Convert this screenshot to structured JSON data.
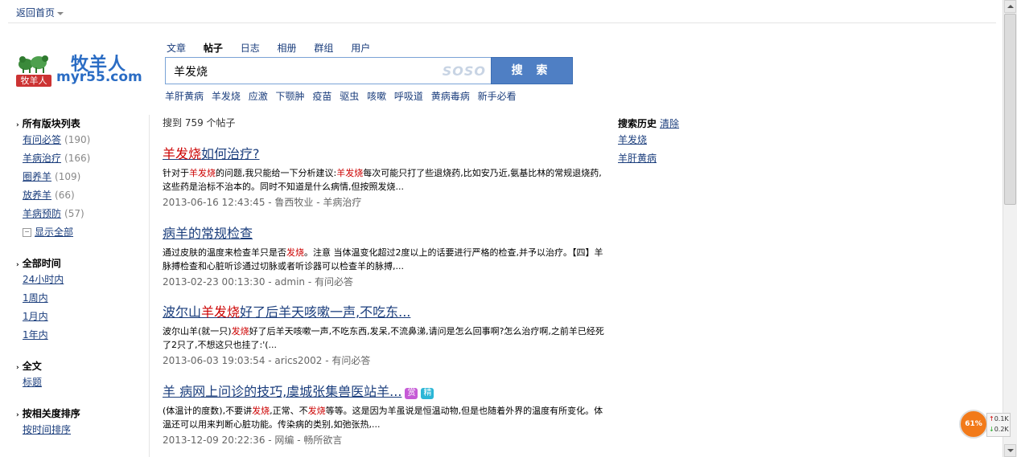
{
  "top": {
    "back_home": "返回首页"
  },
  "logo": {
    "cn": "牧羊人",
    "en": "myr55.com",
    "badge": "牧羊人"
  },
  "search": {
    "tabs": [
      "文章",
      "帖子",
      "日志",
      "相册",
      "群组",
      "用户"
    ],
    "active_tab": "帖子",
    "query": "羊发烧",
    "watermark": "SOSO",
    "button": "搜 索",
    "hot_words": [
      "羊肝黄病",
      "羊发烧",
      "应激",
      "下颚肿",
      "疫苗",
      "驱虫",
      "咳嗽",
      "呼吸道",
      "黄病毒病",
      "新手必看"
    ]
  },
  "sidebar": {
    "forums": {
      "title": "所有版块列表",
      "items": [
        {
          "label": "有问必答",
          "count": "(190)"
        },
        {
          "label": "羊病治疗",
          "count": "(166)"
        },
        {
          "label": "圈养羊",
          "count": "(109)"
        },
        {
          "label": "放养羊",
          "count": "(66)"
        },
        {
          "label": "羊病预防",
          "count": "(57)"
        }
      ],
      "show_all": "显示全部"
    },
    "time": {
      "title": "全部时间",
      "items": [
        "24小时内",
        "1周内",
        "1月内",
        "1年内"
      ]
    },
    "scope": {
      "title": "全文",
      "items": [
        "标题"
      ]
    },
    "sort": {
      "title": "按相关度排序",
      "items": [
        "按时间排序"
      ]
    }
  },
  "results": {
    "count_text": "搜到 759 个帖子",
    "items": [
      {
        "title_hl": "羊发烧",
        "title_rest": "如何治疗?",
        "title_pre": "",
        "desc_1": "针对于",
        "desc_hl1": "羊发烧",
        "desc_2": "的问题,我只能给一下分析建议:",
        "desc_hl2": "羊发烧",
        "desc_3": "每次可能只打了些退烧药,比如安乃近,氨基比林的常规退烧药,这些药是治标不治本的。同时不知道是什么病情,但按照发烧...",
        "meta": "2013-06-16 12:43:45 - 鲁西牧业 - 羊病治疗"
      },
      {
        "title_pre": "病羊的常规检查",
        "title_hl": "",
        "title_rest": "",
        "desc_1": "通过皮肤的温度来检查羊只是否",
        "desc_hl1": "发烧",
        "desc_2": "。注意 当体温变化超过2度以上的话要进行严格的检查,并予以治疗。【四】羊脉搏检查和心脏听诊通过切脉或者听诊器可以检查羊的脉搏,...",
        "desc_hl2": "",
        "desc_3": "",
        "meta": "2013-02-23 00:13:30 - admin - 有问必答"
      },
      {
        "title_pre": "波尔山",
        "title_hl": "羊发烧",
        "title_rest": "好了后羊天咳嗽一声,不吃东...",
        "desc_1": "波尔山羊(就一只)",
        "desc_hl1": "发烧",
        "desc_2": "好了后羊天咳嗽一声,不吃东西,发呆,不流鼻涕,请问是怎么回事啊?怎么治疗啊,之前羊已经死了2只了,不想这只也挂了:'(...",
        "desc_hl2": "",
        "desc_3": "",
        "meta": "2013-06-03 19:03:54 - arics2002 - 有问必答"
      },
      {
        "title_pre": "羊 病网上问诊的技巧,虞城张集兽医站羊...",
        "title_hl": "",
        "title_rest": "",
        "tags": [
          "赏",
          "精"
        ],
        "desc_1": "(体温计的度数),不要讲",
        "desc_hl1": "发烧",
        "desc_2": ",正常、不",
        "desc_hl2": "发烧",
        "desc_3": "等等。这是因为羊虽说是恒温动物,但是也随着外界的温度有所变化。体温还可以用来判断心脏功能。传染病的类别,如弛张热,...",
        "meta": "2013-12-09 20:22:36 - 网编 - 畅所欲言"
      }
    ]
  },
  "history": {
    "title": "搜索历史",
    "clear": "清除",
    "items": [
      "羊发烧",
      "羊肝黄病"
    ]
  },
  "speed_widget": {
    "percent": "61%",
    "up": "0.1K",
    "down": "0.2K"
  }
}
